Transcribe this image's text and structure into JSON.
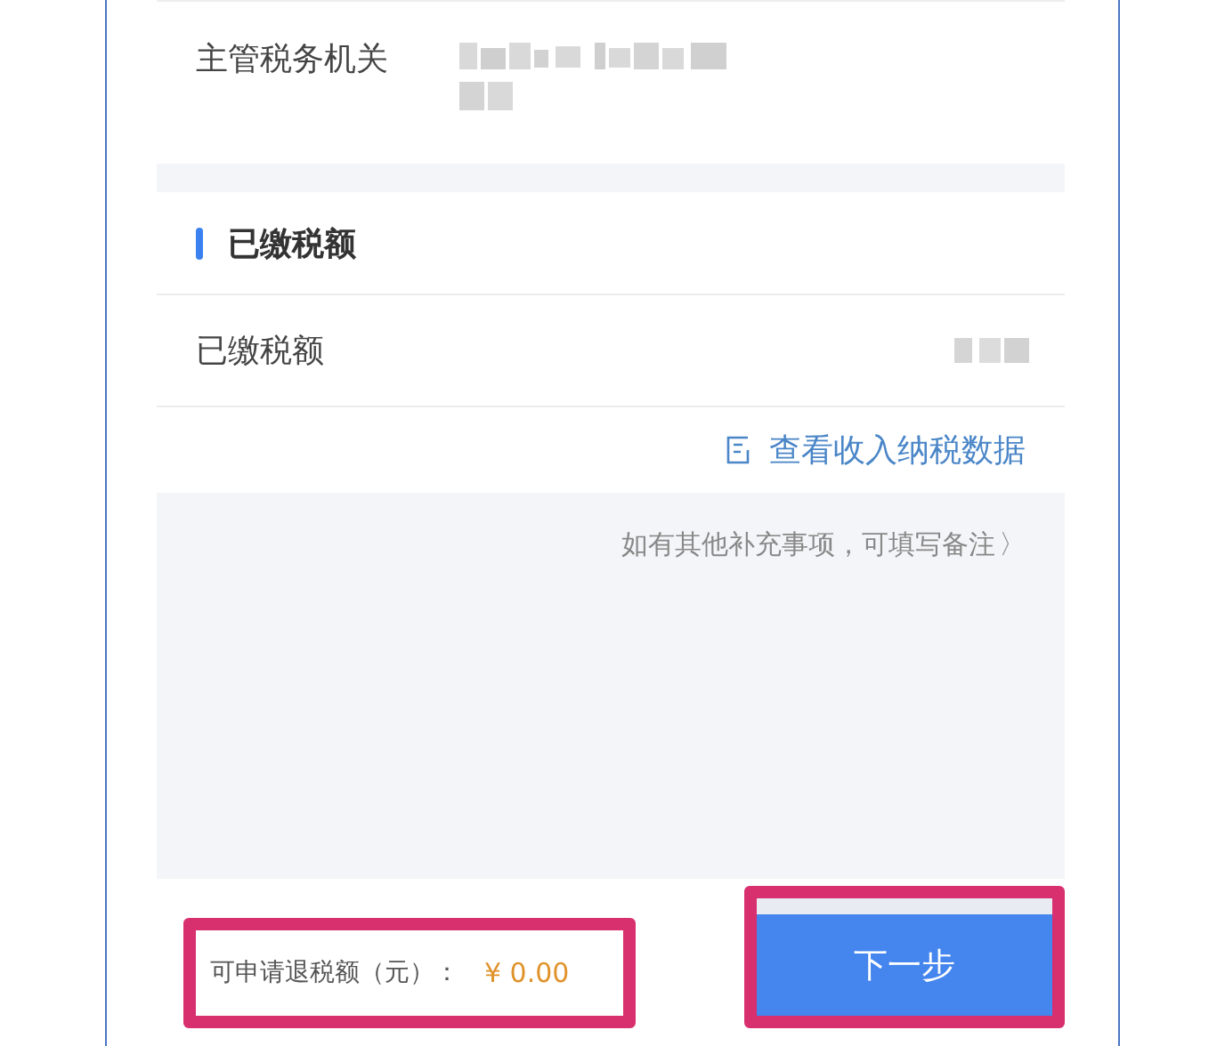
{
  "authority": {
    "label": "主管税务机关",
    "redacted": true
  },
  "paid_section": {
    "title": "已缴税额",
    "rows": [
      {
        "label": "已缴税额",
        "redacted": true
      }
    ]
  },
  "data_link": {
    "label": "查看收入纳税数据"
  },
  "remark_hint": {
    "label": "如有其他补充事项，可填写备注",
    "chevron": "〉"
  },
  "footer": {
    "refund_label": "可申请退税额（元）：",
    "refund_value": "¥ 0.00",
    "highlighted": true,
    "next_button": {
      "label": "下一步",
      "highlighted": true
    }
  }
}
